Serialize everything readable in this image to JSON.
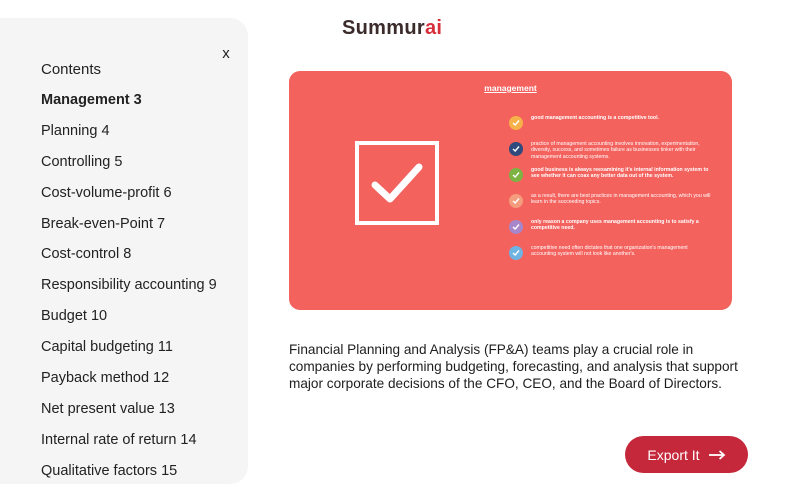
{
  "sidebar": {
    "close_label": "x",
    "title": "Contents",
    "items": [
      {
        "label": "Management 3",
        "active": true
      },
      {
        "label": "Planning 4"
      },
      {
        "label": "Controlling 5"
      },
      {
        "label": "Cost-volume-profit 6"
      },
      {
        "label": "Break-even-Point 7"
      },
      {
        "label": "Cost-control 8"
      },
      {
        "label": "Responsibility accounting 9"
      },
      {
        "label": "Budget 10"
      },
      {
        "label": "Capital budgeting 11"
      },
      {
        "label": "Payback method 12"
      },
      {
        "label": "Net present value 13"
      },
      {
        "label": "Internal rate of return 14"
      },
      {
        "label": "Qualitative factors 15"
      }
    ]
  },
  "logo": {
    "main": "Summur",
    "accent": "ai"
  },
  "slide": {
    "title": "management",
    "background": "#f4625e",
    "bullets": [
      {
        "text": "good management accounting is a competitive tool.",
        "bold": true,
        "color": "#f6b14a"
      },
      {
        "text": "practice of management accounting involves innovation, experimentation, diversity, success, and sometimes failure as businesses tinker with their management accounting systems.",
        "bold": false,
        "color": "#2f4a7c"
      },
      {
        "text": "good business is always reexamining it's internal information system to see whether it can coax any better data out of the system.",
        "bold": true,
        "color": "#7cb342"
      },
      {
        "text": "as a result, there are best practices in management accounting, which you will learn in the succeeding topics.",
        "bold": false,
        "color": "#f59b7e"
      },
      {
        "text": "only reason a company uses management accounting is to satisfy a competitive need.",
        "bold": true,
        "color": "#a786c9"
      },
      {
        "text": "competitive need often dictates that one organization's management accounting system will not look like another's.",
        "bold": false,
        "color": "#6fb3e3"
      }
    ]
  },
  "description": "Financial Planning and Analysis (FP&A) teams play a crucial role in companies by performing budgeting, forecasting, and analysis that support major corporate decisions of the CFO, CEO, and the Board of Directors.",
  "export_button": {
    "label": "Export It",
    "color": "#c5283a"
  }
}
